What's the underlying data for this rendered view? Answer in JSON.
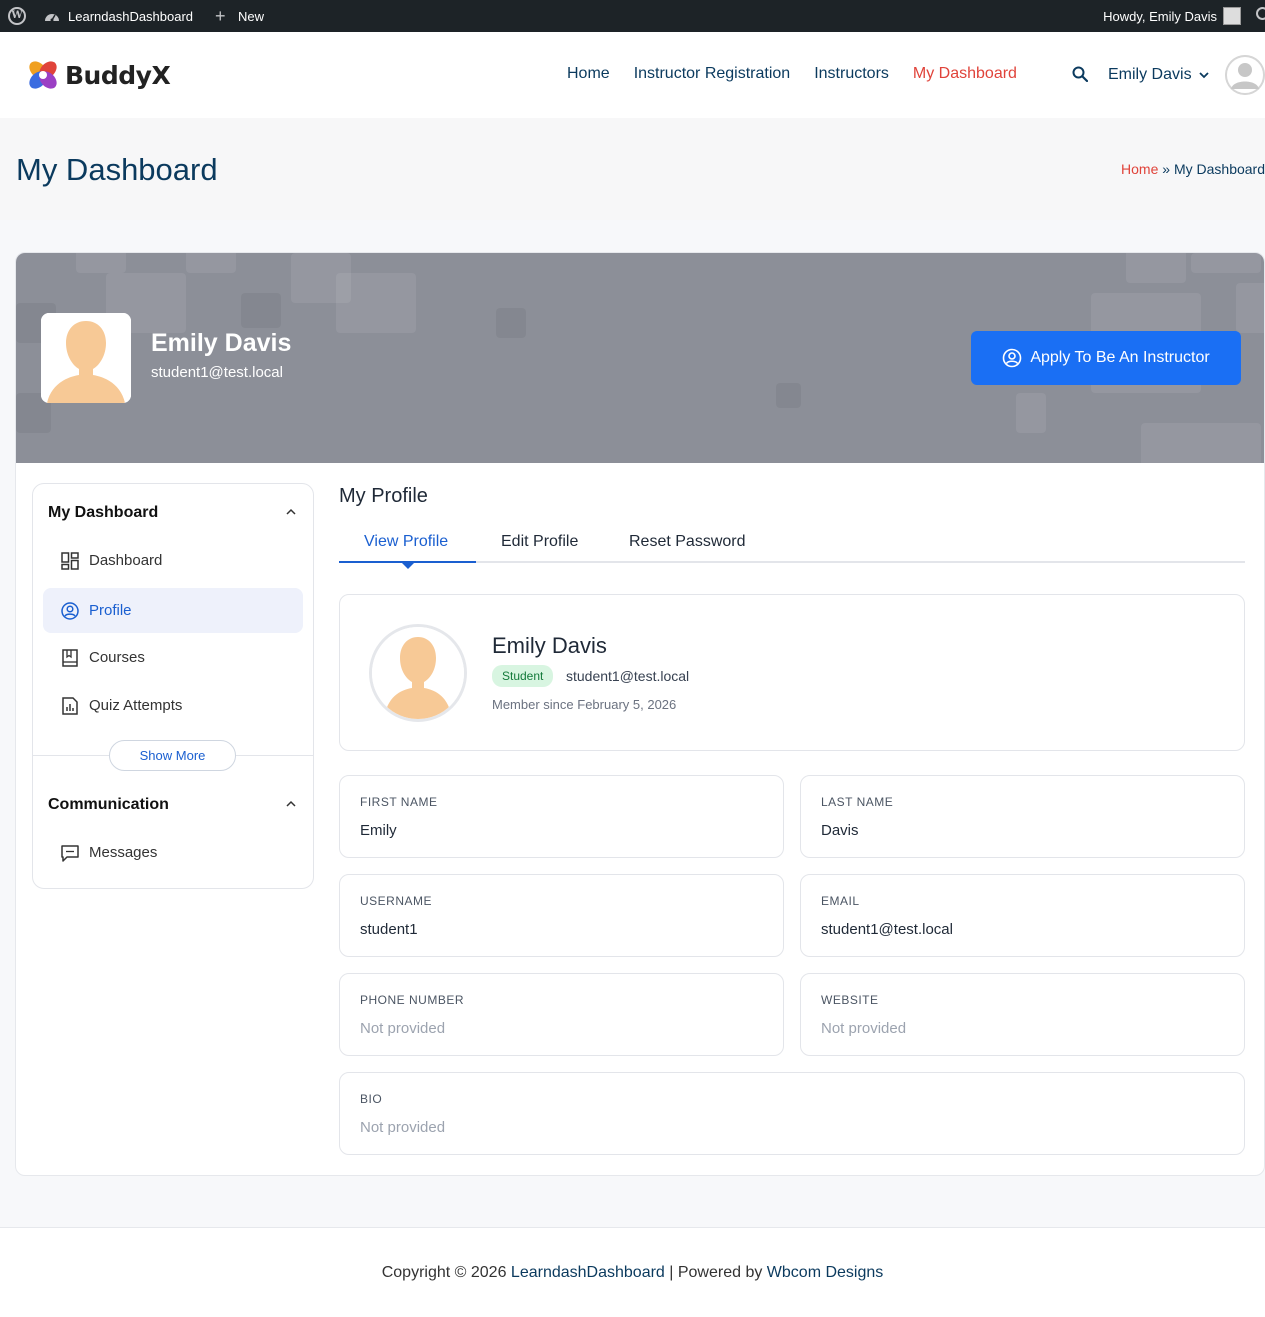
{
  "adminbar": {
    "site_name": "LearndashDashboard",
    "new_label": "New",
    "howdy": "Howdy, Emily Davis"
  },
  "header": {
    "logo_text": "BuddyX",
    "nav": [
      "Home",
      "Instructor Registration",
      "Instructors",
      "My Dashboard"
    ],
    "active_nav": "My Dashboard",
    "user_name": "Emily Davis"
  },
  "page": {
    "title": "My Dashboard",
    "breadcrumb_home": "Home",
    "breadcrumb_sep": "»",
    "breadcrumb_current": "My Dashboard"
  },
  "cover": {
    "name": "Emily Davis",
    "email": "student1@test.local",
    "apply_label": "Apply To Be An Instructor"
  },
  "sidebar": {
    "section1_title": "My Dashboard",
    "items": [
      {
        "label": "Dashboard",
        "icon": "dashboard-icon"
      },
      {
        "label": "Profile",
        "icon": "profile-icon"
      },
      {
        "label": "Courses",
        "icon": "book-icon"
      },
      {
        "label": "Quiz Attempts",
        "icon": "report-icon"
      }
    ],
    "active_item": "Profile",
    "show_more": "Show More",
    "section2_title": "Communication",
    "items2": [
      {
        "label": "Messages",
        "icon": "message-icon"
      }
    ]
  },
  "profile": {
    "heading": "My Profile",
    "tabs": [
      "View Profile",
      "Edit Profile",
      "Reset Password"
    ],
    "active_tab": "View Profile",
    "summary": {
      "name": "Emily Davis",
      "role": "Student",
      "email": "student1@test.local",
      "member_since": "Member since February 5, 2026"
    },
    "fields": [
      {
        "label": "FIRST NAME",
        "value": "Emily"
      },
      {
        "label": "LAST NAME",
        "value": "Davis"
      },
      {
        "label": "USERNAME",
        "value": "student1"
      },
      {
        "label": "EMAIL",
        "value": "student1@test.local"
      },
      {
        "label": "PHONE NUMBER",
        "value": "Not provided"
      },
      {
        "label": "WEBSITE",
        "value": "Not provided"
      },
      {
        "label": "BIO",
        "value": "Not provided"
      }
    ]
  },
  "footer": {
    "prefix": "Copyright © 2026 ",
    "site_link": "LearndashDashboard",
    "middle": " | Powered by ",
    "powered_link": "Wbcom Designs"
  },
  "colors": {
    "brand_navy": "#0b3a5e",
    "accent_red": "#e0433a",
    "primary_blue": "#1a6ff4",
    "badge_green_bg": "#d8f5e1"
  }
}
